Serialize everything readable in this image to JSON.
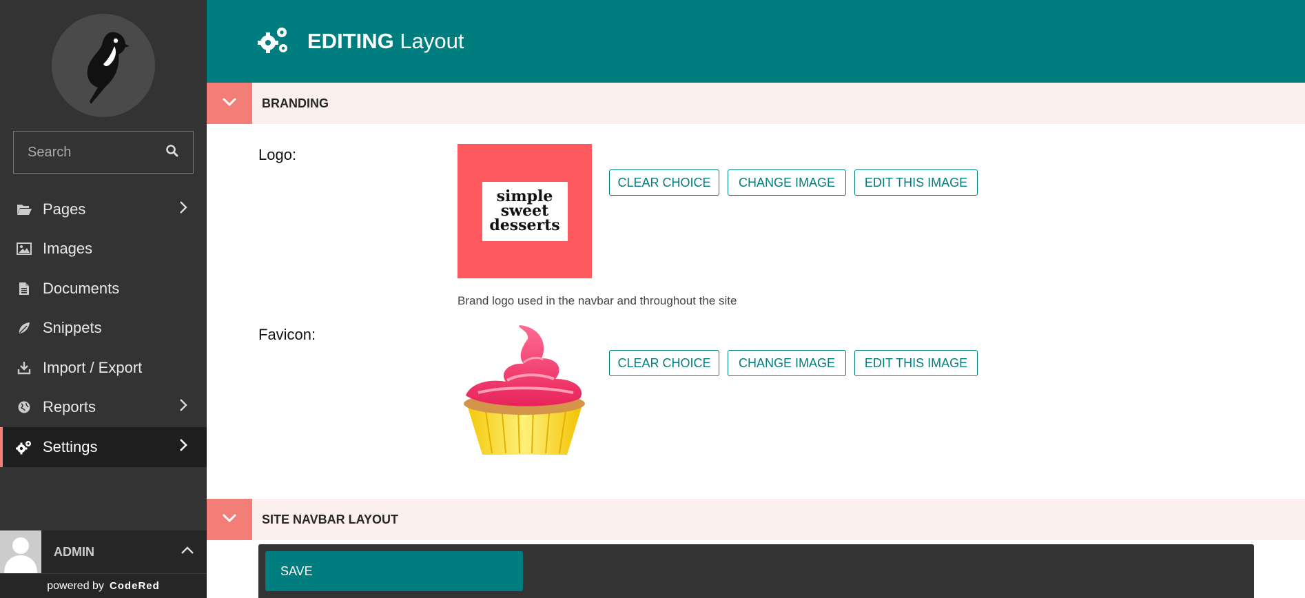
{
  "sidebar": {
    "search": {
      "placeholder": "Search"
    },
    "items": [
      {
        "label": "Pages",
        "icon": "folder-open-icon",
        "has_submenu": true
      },
      {
        "label": "Images",
        "icon": "image-icon",
        "has_submenu": false
      },
      {
        "label": "Documents",
        "icon": "document-icon",
        "has_submenu": false
      },
      {
        "label": "Snippets",
        "icon": "snippet-icon",
        "has_submenu": false
      },
      {
        "label": "Import / Export",
        "icon": "download-icon",
        "has_submenu": false
      },
      {
        "label": "Reports",
        "icon": "globe-icon",
        "has_submenu": true
      },
      {
        "label": "Settings",
        "icon": "cogs-icon",
        "has_submenu": true,
        "active": true
      }
    ],
    "account": {
      "name": "ADMIN"
    },
    "powered_by": {
      "prefix": "powered by",
      "brand": "CodeRed"
    }
  },
  "header": {
    "strong": "EDITING",
    "rest": "Layout"
  },
  "panels": {
    "branding": {
      "title": "BRANDING",
      "logo": {
        "label": "Logo:",
        "image_text": [
          "simple",
          "sweet",
          "desserts"
        ],
        "help": "Brand logo used in the navbar and throughout the site",
        "clear": "CLEAR CHOICE",
        "change": "CHANGE IMAGE",
        "edit": "EDIT THIS IMAGE"
      },
      "favicon": {
        "label": "Favicon:",
        "clear": "CLEAR CHOICE",
        "change": "CHANGE IMAGE",
        "edit": "EDIT THIS IMAGE"
      }
    },
    "navbar": {
      "title": "SITE NAVBAR LAYOUT"
    }
  },
  "footer": {
    "save": "SAVE"
  },
  "colors": {
    "accent": "#007d7e",
    "salmon": "#f37e77",
    "sidebar": "#333333",
    "logo_bg": "#ff5a5f"
  }
}
